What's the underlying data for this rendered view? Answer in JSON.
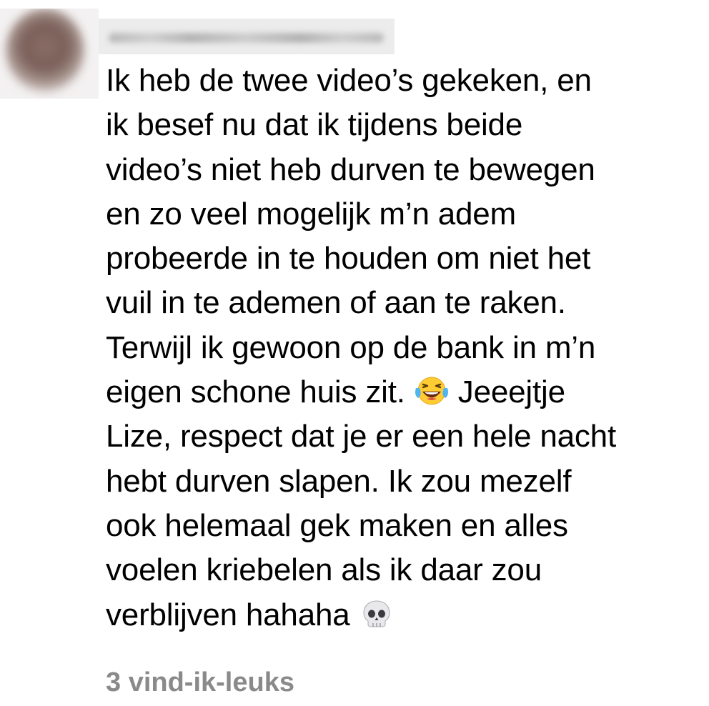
{
  "comment": {
    "author_name": "",
    "text_part1": "Ik heb de twee video’s gekeken, en\nik besef nu dat ik tijdens beide\nvideo’s niet heb durven te bewegen\nen zo veel mogelijk m’n adem\nprobeerde in te houden om niet het\nvuil in te ademen of aan te raken.\nTerwijl ik gewoon op de bank in m’n\neigen schone huis zit. ",
    "emoji1": "face-with-tears-of-joy",
    "text_part2": " Jeeejtje\nLize, respect dat je er een hele nacht\nhebt durven slapen. Ik zou mezelf\nook helemaal gek maken en alles\nvoelen kriebelen als ik daar zou\nverblijven hahaha ",
    "emoji2": "skull",
    "likes": "3 vind-ik-leuks"
  },
  "colors": {
    "text": "#000000",
    "likes": "#8a8a8a",
    "background": "#ffffff"
  }
}
